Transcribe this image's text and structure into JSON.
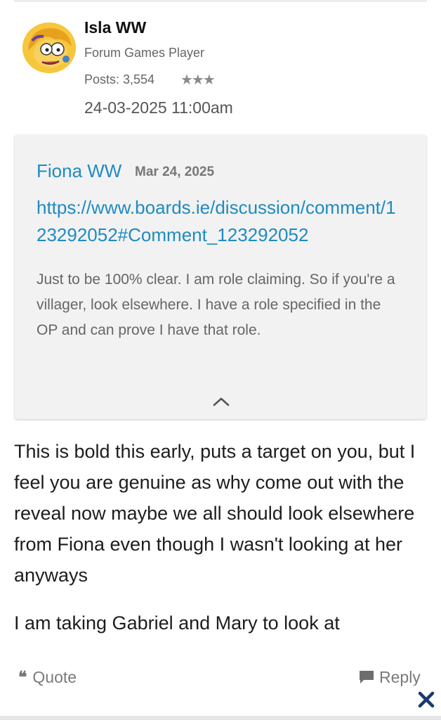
{
  "author": {
    "name": "Isla WW",
    "title": "Forum Games Player",
    "posts": "Posts: 3,554",
    "rank_stars": "★★★",
    "date": "24-03-2025 11:00am"
  },
  "quote": {
    "author": "Fiona WW",
    "date": "Mar 24, 2025",
    "link": "https://www.boards.ie/discussion/comment/123292052#Comment_123292052",
    "text": "Just to be 100% clear. I am role claiming. So if you're a villager, look elsewhere. I have a role specified in the OP and can prove I have that role."
  },
  "post": {
    "paragraphs": [
      "This is bold this early, puts a target on you, but I feel you are genuine as why come out with the reveal now maybe we all should look elsewhere from Fiona even though I wasn't looking at her anyways",
      "I am taking Gabriel and Mary to look at"
    ]
  },
  "actions": {
    "quote_icon": "❝",
    "quote_label": "Quote",
    "reply_label": "Reply"
  },
  "icons": {
    "avatar": "avatar-image",
    "collapse": "chevron-up-icon",
    "reply": "speech-bubble-icon",
    "close": "close-icon"
  },
  "colors": {
    "link": "#1f8bc2",
    "close": "#1a3a6e",
    "quote_bg": "#f2f2f2"
  }
}
